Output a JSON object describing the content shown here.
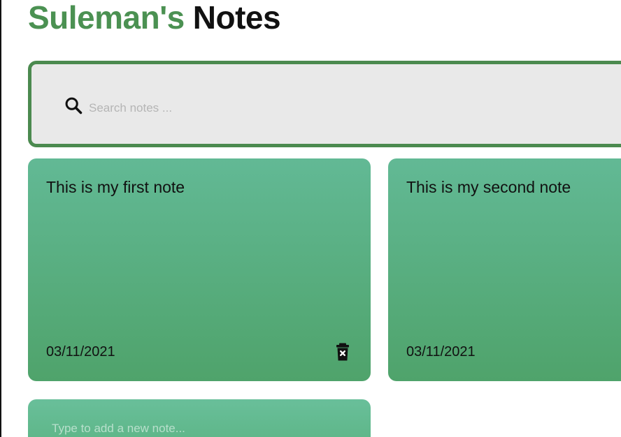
{
  "header": {
    "brand": "Suleman's",
    "title": "Notes"
  },
  "search": {
    "placeholder": "Search notes ..."
  },
  "notes": [
    {
      "text": "This is my first note",
      "date": "03/11/2021"
    },
    {
      "text": "This is my second note",
      "date": "03/11/2021"
    }
  ],
  "new_note": {
    "placeholder": "Type to add a new note..."
  },
  "colors": {
    "brand_green": "#4b9152",
    "search_border": "#4b8a4f",
    "note_gradient_top": "#62b995",
    "note_gradient_bottom": "#4fa36b",
    "search_bg": "#e9e9e9"
  },
  "icons": {
    "search": "search-icon",
    "delete": "trash-icon"
  }
}
